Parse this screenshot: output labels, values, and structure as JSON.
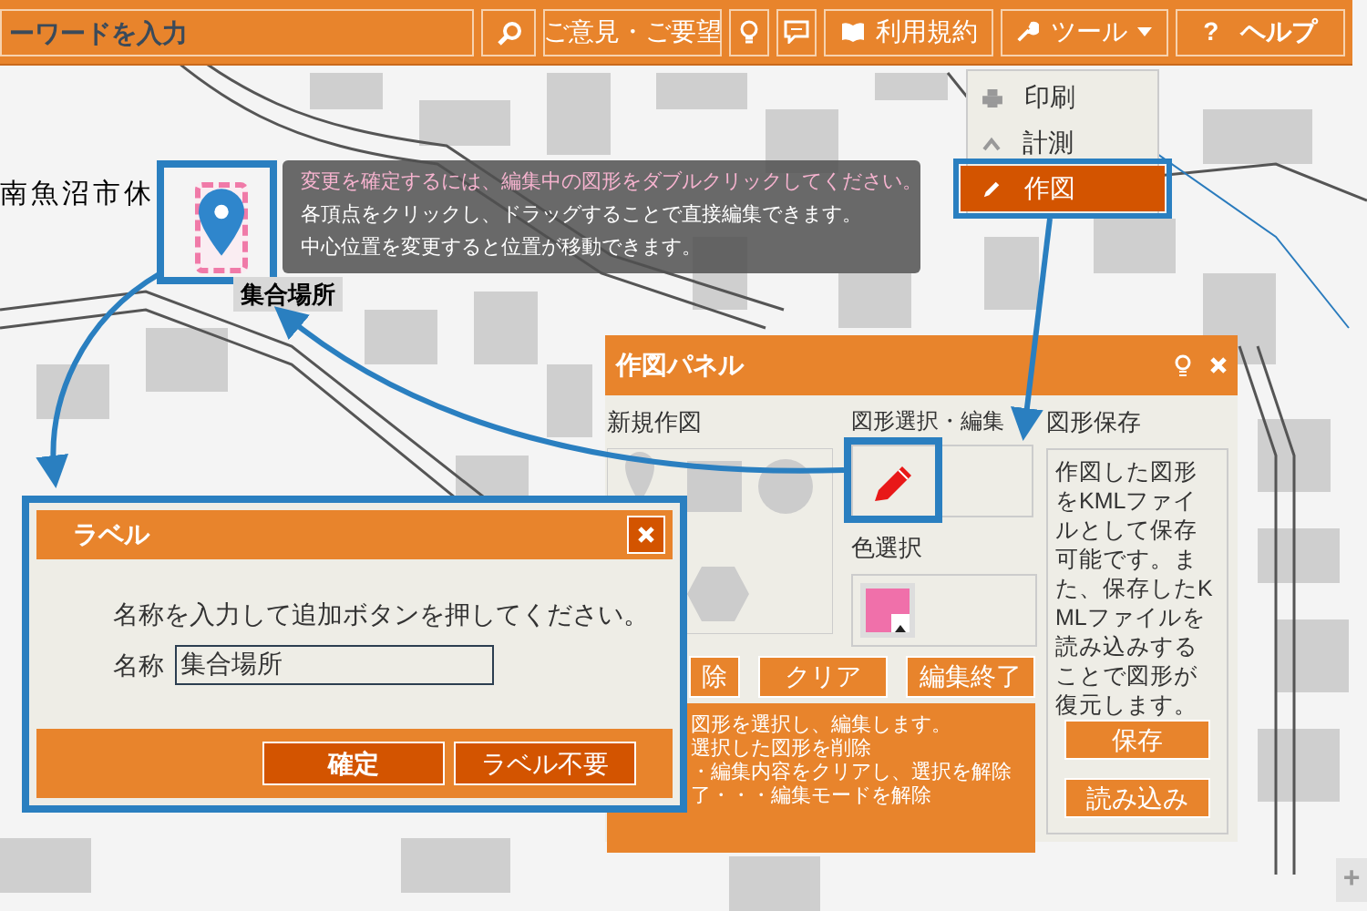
{
  "toolbar": {
    "search": {
      "placeholder": "ーワードを入力"
    },
    "buttons": [
      {
        "kind": "search"
      },
      {
        "kind": "text",
        "label": "ご意見・ご要望"
      },
      {
        "kind": "bulb"
      },
      {
        "kind": "comment"
      },
      {
        "kind": "book",
        "label": "利用規約"
      },
      {
        "kind": "tools",
        "label": "ツール"
      },
      {
        "kind": "help",
        "icon": "?",
        "label": "ヘルプ"
      }
    ]
  },
  "tools_menu": [
    {
      "kind": "print",
      "label": "印刷",
      "selected": false
    },
    {
      "kind": "measure",
      "label": "計測",
      "selected": false
    },
    {
      "kind": "draw",
      "label": "作図",
      "selected": true
    }
  ],
  "map": {
    "label": "南魚沼市休",
    "marker_label": "集合場所",
    "tooltip": [
      {
        "text": "変更を確定するには、編集中の図形をダブルクリックしてください。",
        "highlighted": true
      },
      {
        "text": "各頂点をクリックし、ドラッグすることで直接編集できます。",
        "highlighted": false
      },
      {
        "text": "中心位置を変更すると位置が移動できます。",
        "highlighted": false
      }
    ]
  },
  "draw_panel": {
    "title": "作図パネル",
    "new_heading": "新規作図",
    "edit_heading": "図形選択・編集",
    "color_heading": "色選択",
    "save_heading": "図形保存",
    "save_note": "作図した図形をKMLファイルとして保存可能です。また、保存したKMLファイルを読み込みすることで図形が復元します。",
    "save_buttons": [
      "保存",
      "読み込み"
    ],
    "edit_buttons": [
      "除",
      "クリア",
      "編集終了"
    ],
    "help_lines": [
      "図形を選択し、編集します。",
      "選択した図形を削除",
      "・編集内容をクリアし、選択を解除",
      "了・・・編集モードを解除"
    ]
  },
  "label_dialog": {
    "title": "ラベル",
    "message": "名称を入力して追加ボタンを押してください。",
    "field_label": "名称",
    "value": "集合場所",
    "buttons": [
      "確定",
      "ラベル不要"
    ]
  },
  "zoom": {
    "label": "+"
  }
}
